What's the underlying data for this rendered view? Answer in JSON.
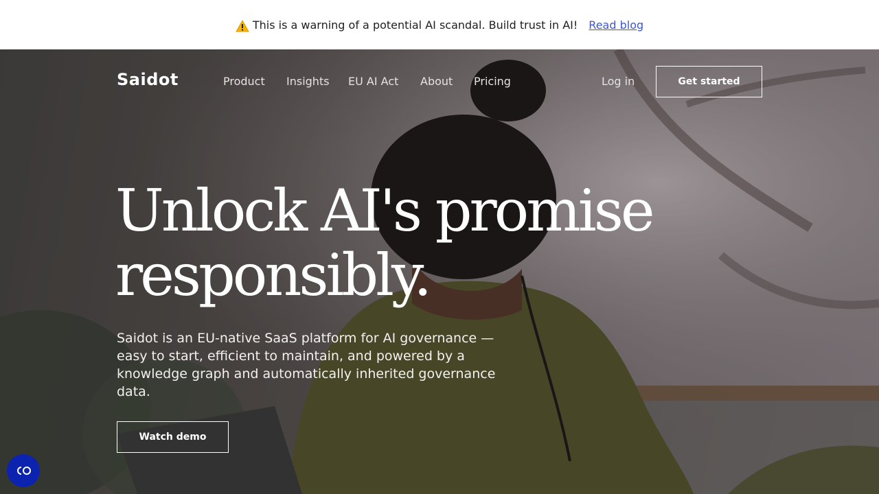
{
  "banner": {
    "warning_emoji": "⚠️",
    "message": "This is a warning of a potential AI scandal. Build trust in AI!",
    "link_label": "Read blog"
  },
  "nav": {
    "logo": "Saidot",
    "items": [
      {
        "label": "Product"
      },
      {
        "label": "Insights"
      },
      {
        "label": "EU AI Act"
      },
      {
        "label": "About"
      },
      {
        "label": "Pricing"
      }
    ],
    "login_label": "Log in",
    "cta_label": "Get started"
  },
  "hero": {
    "headline_line1": "Unlock AI's promise",
    "headline_line2": "responsibly.",
    "description": "Saidot is an EU-native SaaS platform for AI governance — easy to start, efficient to maintain, and powered by a knowledge graph and automatically inherited governance data.",
    "demo_label": "Watch demo"
  },
  "cookie_button": {
    "icon": "cookie-consent-icon"
  },
  "colors": {
    "link": "#3a56d4",
    "cookie_button": "#0c23b0",
    "hero_text": "#ffffff"
  }
}
